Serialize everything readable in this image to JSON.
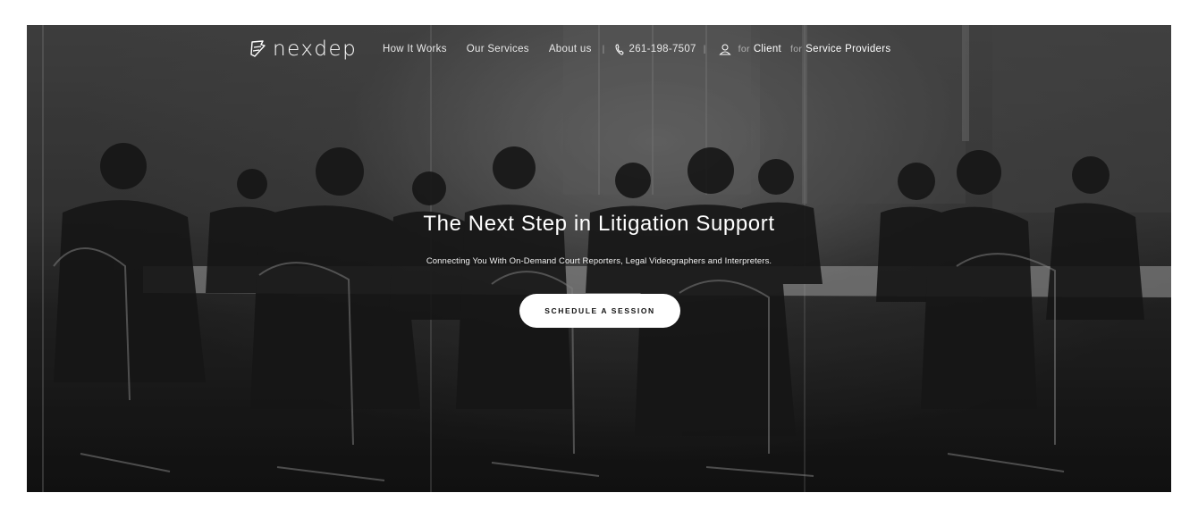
{
  "brand": {
    "name": "nexdep",
    "logo_icon": "nexdep-logo-mark"
  },
  "nav": {
    "links": [
      {
        "label": "How It Works"
      },
      {
        "label": "Our Services"
      },
      {
        "label": "About us"
      }
    ],
    "phone": {
      "icon": "phone-icon",
      "number": "261-198-7507"
    },
    "user_icon": "user-icon",
    "for_word": "for",
    "client_label": "Client",
    "providers_label": "Service Providers"
  },
  "hero": {
    "headline": "The Next Step in Litigation Support",
    "subheadline": "Connecting You With On-Demand Court Reporters, Legal Videographers and Interpreters.",
    "cta_label": "SCHEDULE A SESSION"
  },
  "colors": {
    "page_background": "#ffffff",
    "hero_tint": "#2a2a2a",
    "cta_background": "#ffffff",
    "text_on_hero": "#ffffff"
  }
}
